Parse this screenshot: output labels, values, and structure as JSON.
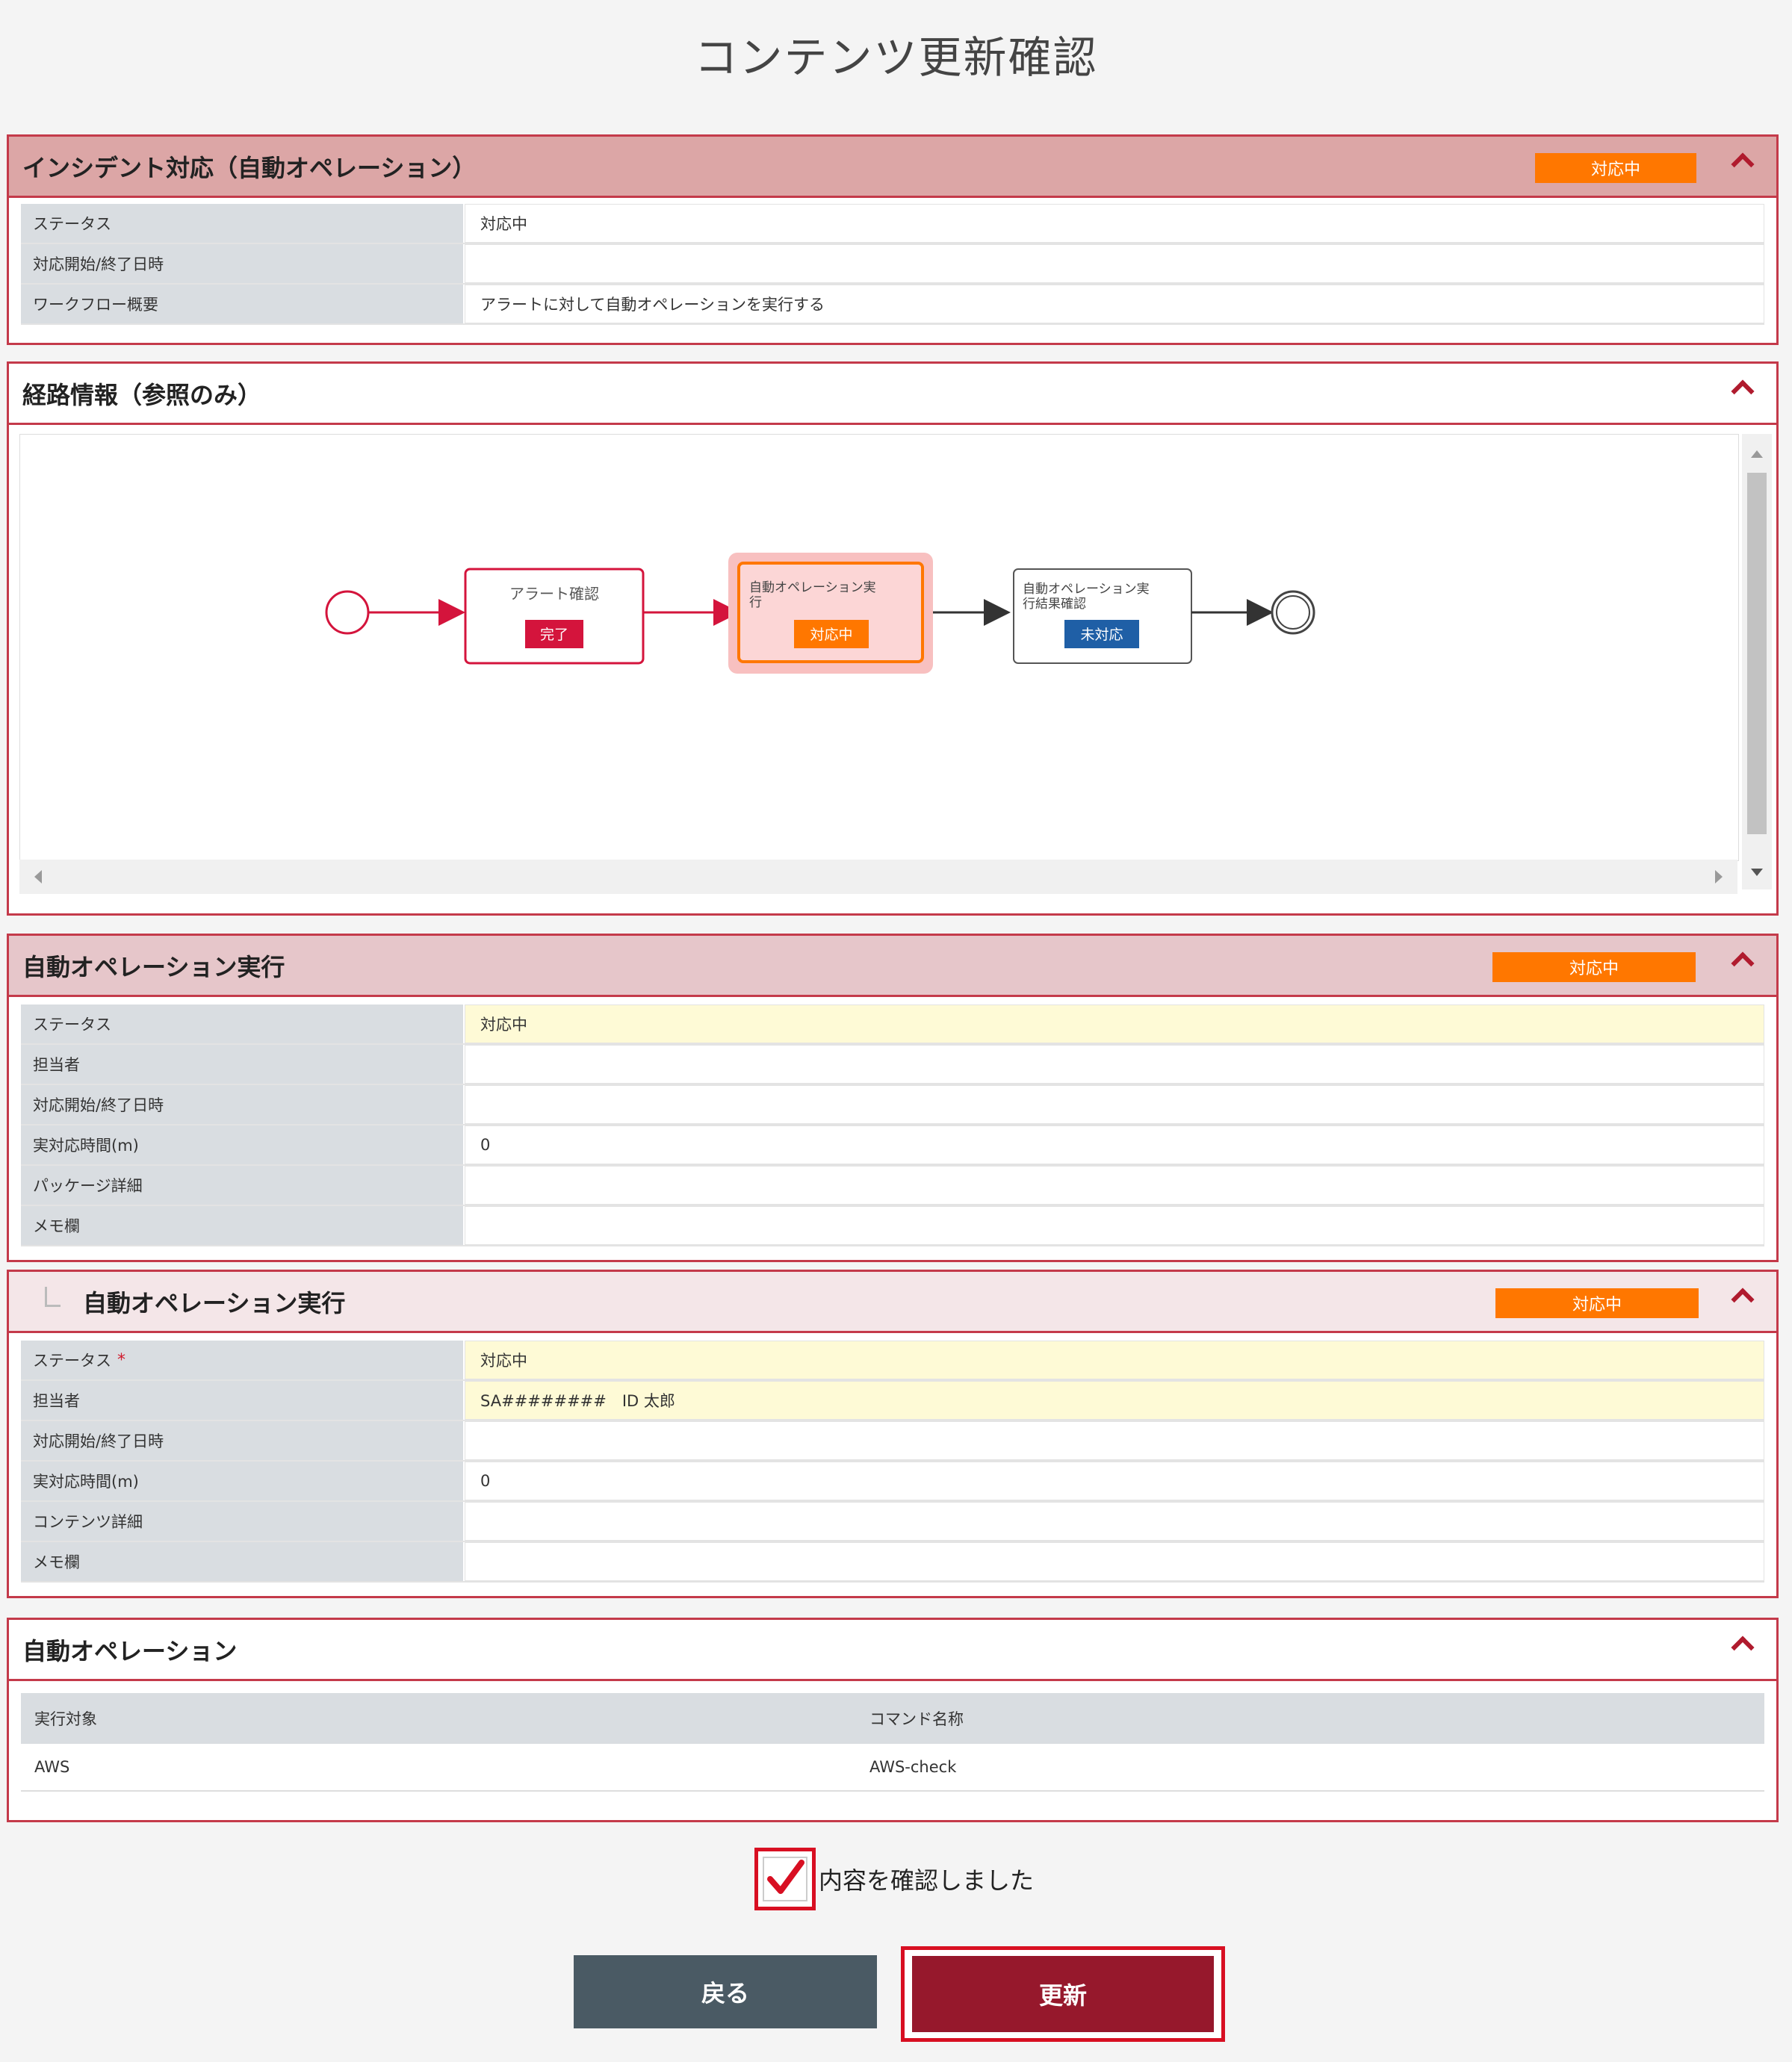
{
  "page": {
    "title": "コンテンツ更新確認"
  },
  "incident": {
    "title": "インシデント対応（自動オペレーション）",
    "badge": "対応中",
    "rows": [
      {
        "label": "ステータス",
        "value": "対応中"
      },
      {
        "label": "対応開始/終了日時",
        "value": ""
      },
      {
        "label": "ワークフロー概要",
        "value": "アラートに対して自動オペレーションを実行する"
      }
    ]
  },
  "route": {
    "title": "経路情報（参照のみ）",
    "nodes": [
      {
        "label": "アラート確認",
        "status": "完了",
        "status_color": "#d4143c"
      },
      {
        "label": "自動オペレーション実行",
        "status": "対応中",
        "status_color": "#ff7700"
      },
      {
        "label": "自動オペレーション実行結果確認",
        "status": "未対応",
        "status_color": "#1f5fa6"
      }
    ]
  },
  "auto_exec": {
    "title": "自動オペレーション実行",
    "badge": "対応中",
    "rows": [
      {
        "label": "ステータス",
        "value": "対応中"
      },
      {
        "label": "担当者",
        "value": ""
      },
      {
        "label": "対応開始/終了日時",
        "value": ""
      },
      {
        "label": "実対応時間(m)",
        "value": "0"
      },
      {
        "label": "パッケージ詳細",
        "value": ""
      },
      {
        "label": "メモ欄",
        "value": ""
      }
    ]
  },
  "auto_exec_sub": {
    "title": "自動オペレーション実行",
    "badge": "対応中",
    "required_mark": "*",
    "rows": [
      {
        "label": "ステータス",
        "value": "対応中"
      },
      {
        "label": "担当者",
        "value": "SA########　ID 太郎"
      },
      {
        "label": "対応開始/終了日時",
        "value": ""
      },
      {
        "label": "実対応時間(m)",
        "value": "0"
      },
      {
        "label": "コンテンツ詳細",
        "value": ""
      },
      {
        "label": "メモ欄",
        "value": ""
      }
    ]
  },
  "auto_op": {
    "title": "自動オペレーション",
    "headers": [
      "実行対象",
      "コマンド名称"
    ],
    "rows": [
      [
        "AWS",
        "AWS-check"
      ]
    ]
  },
  "confirm": {
    "label": "内容を確認しました",
    "checked": true
  },
  "buttons": {
    "back": "戻る",
    "update": "更新"
  },
  "colors": {
    "accent": "#c43a4a",
    "badge": "#ff7700",
    "update": "#96182c",
    "back": "#4a5a64"
  }
}
